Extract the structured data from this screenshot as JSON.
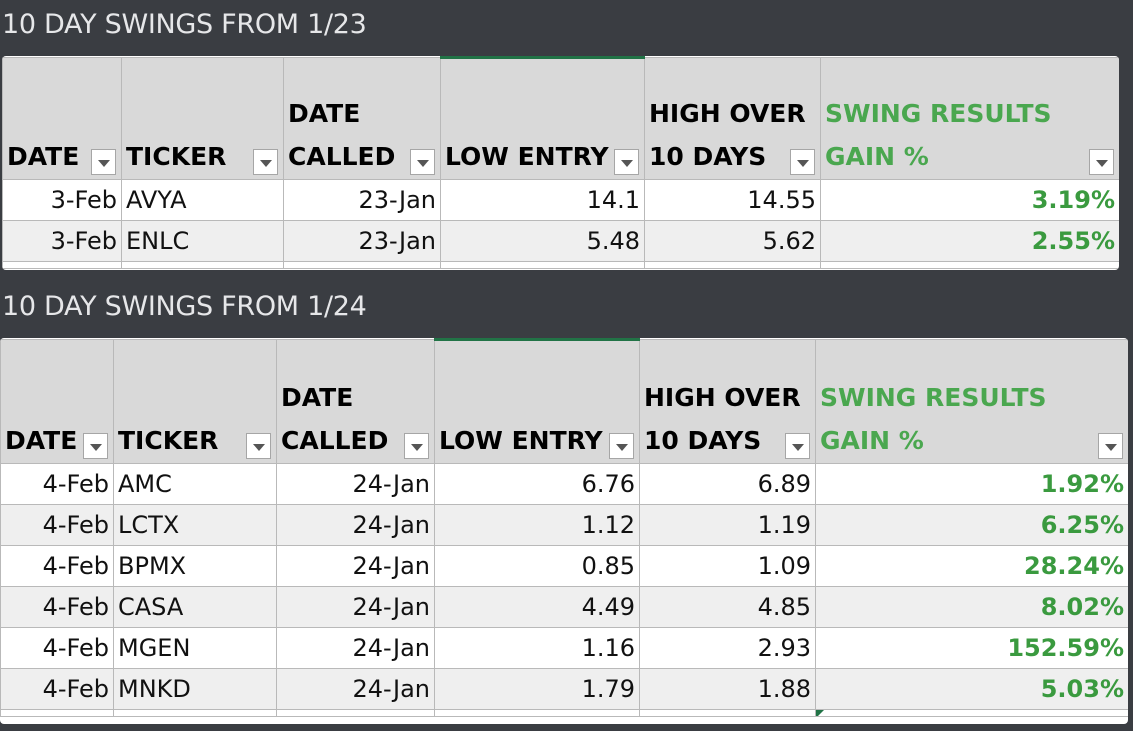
{
  "sections": [
    {
      "title": "10 DAY SWINGS FROM 1/23",
      "headers": {
        "date": [
          "DATE"
        ],
        "ticker": [
          "TICKER"
        ],
        "called": [
          "DATE",
          "CALLED"
        ],
        "low": [
          "LOW ENTRY"
        ],
        "high": [
          "HIGH OVER",
          "10 DAYS"
        ],
        "gain": [
          "SWING RESULTS",
          "GAIN %"
        ]
      },
      "rows": [
        {
          "date": "3-Feb",
          "ticker": "AVYA",
          "called": "23-Jan",
          "low": "14.1",
          "high": "14.55",
          "gain": "3.19%"
        },
        {
          "date": "3-Feb",
          "ticker": "ENLC",
          "called": "23-Jan",
          "low": "5.48",
          "high": "5.62",
          "gain": "2.55%"
        }
      ]
    },
    {
      "title": "10 DAY SWINGS FROM 1/24",
      "headers": {
        "date": [
          "DATE"
        ],
        "ticker": [
          "TICKER"
        ],
        "called": [
          "DATE",
          "CALLED"
        ],
        "low": [
          "LOW ENTRY"
        ],
        "high": [
          "HIGH OVER",
          "10 DAYS"
        ],
        "gain": [
          "SWING RESULTS",
          "GAIN %"
        ]
      },
      "rows": [
        {
          "date": "4-Feb",
          "ticker": "AMC",
          "called": "24-Jan",
          "low": "6.76",
          "high": "6.89",
          "gain": "1.92%"
        },
        {
          "date": "4-Feb",
          "ticker": "LCTX",
          "called": "24-Jan",
          "low": "1.12",
          "high": "1.19",
          "gain": "6.25%"
        },
        {
          "date": "4-Feb",
          "ticker": "BPMX",
          "called": "24-Jan",
          "low": "0.85",
          "high": "1.09",
          "gain": "28.24%"
        },
        {
          "date": "4-Feb",
          "ticker": "CASA",
          "called": "24-Jan",
          "low": "4.49",
          "high": "4.85",
          "gain": "8.02%"
        },
        {
          "date": "4-Feb",
          "ticker": "MGEN",
          "called": "24-Jan",
          "low": "1.16",
          "high": "2.93",
          "gain": "152.59%"
        },
        {
          "date": "4-Feb",
          "ticker": "MNKD",
          "called": "24-Jan",
          "low": "1.79",
          "high": "1.88",
          "gain": "5.03%"
        }
      ]
    }
  ]
}
